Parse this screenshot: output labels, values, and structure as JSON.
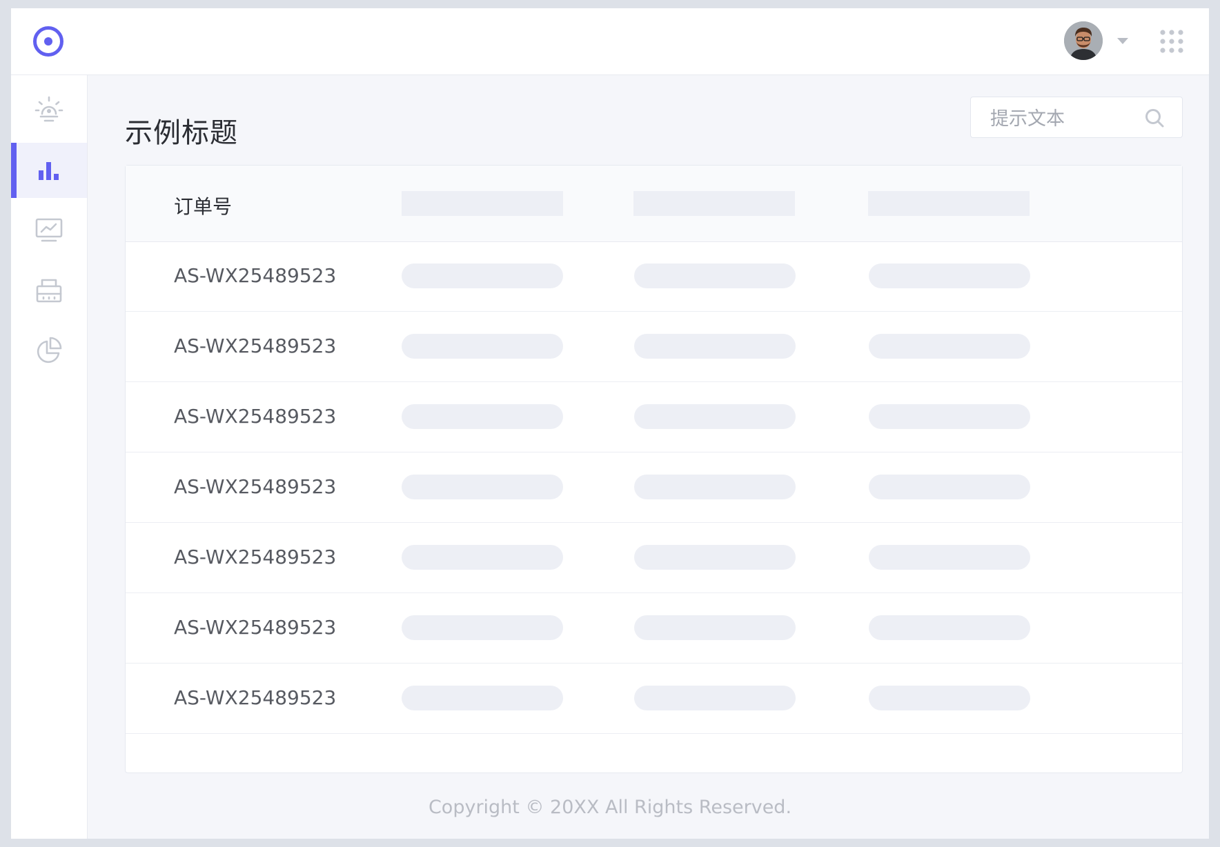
{
  "header": {
    "logo_icon": "ring-logo-icon",
    "avatar_icon": "user-avatar",
    "menu_caret_icon": "caret-down-icon",
    "apps_icon": "apps-grid-icon"
  },
  "sidebar": {
    "items": [
      {
        "name": "alarm",
        "icon": "alarm-light-icon",
        "active": false
      },
      {
        "name": "bar-chart",
        "icon": "bar-chart-icon",
        "active": true
      },
      {
        "name": "monitor",
        "icon": "monitor-chart-icon",
        "active": false
      },
      {
        "name": "printer",
        "icon": "printer-icon",
        "active": false
      },
      {
        "name": "pie-chart",
        "icon": "pie-chart-icon",
        "active": false
      }
    ]
  },
  "main": {
    "title": "示例标题",
    "search": {
      "placeholder": "提示文本",
      "value": ""
    }
  },
  "table": {
    "columns": [
      "订单号"
    ],
    "rows": [
      {
        "order_id": "AS-WX25489523"
      },
      {
        "order_id": "AS-WX25489523"
      },
      {
        "order_id": "AS-WX25489523"
      },
      {
        "order_id": "AS-WX25489523"
      },
      {
        "order_id": "AS-WX25489523"
      },
      {
        "order_id": "AS-WX25489523"
      },
      {
        "order_id": "AS-WX25489523"
      }
    ]
  },
  "footer": {
    "copyright": "Copyright © 20XX All Rights Reserved."
  },
  "colors": {
    "accent": "#6160f0",
    "sidebar_icon": "#c4c8d0",
    "placeholder_bar": "#edeff5",
    "page_bg": "#f5f6fa"
  }
}
